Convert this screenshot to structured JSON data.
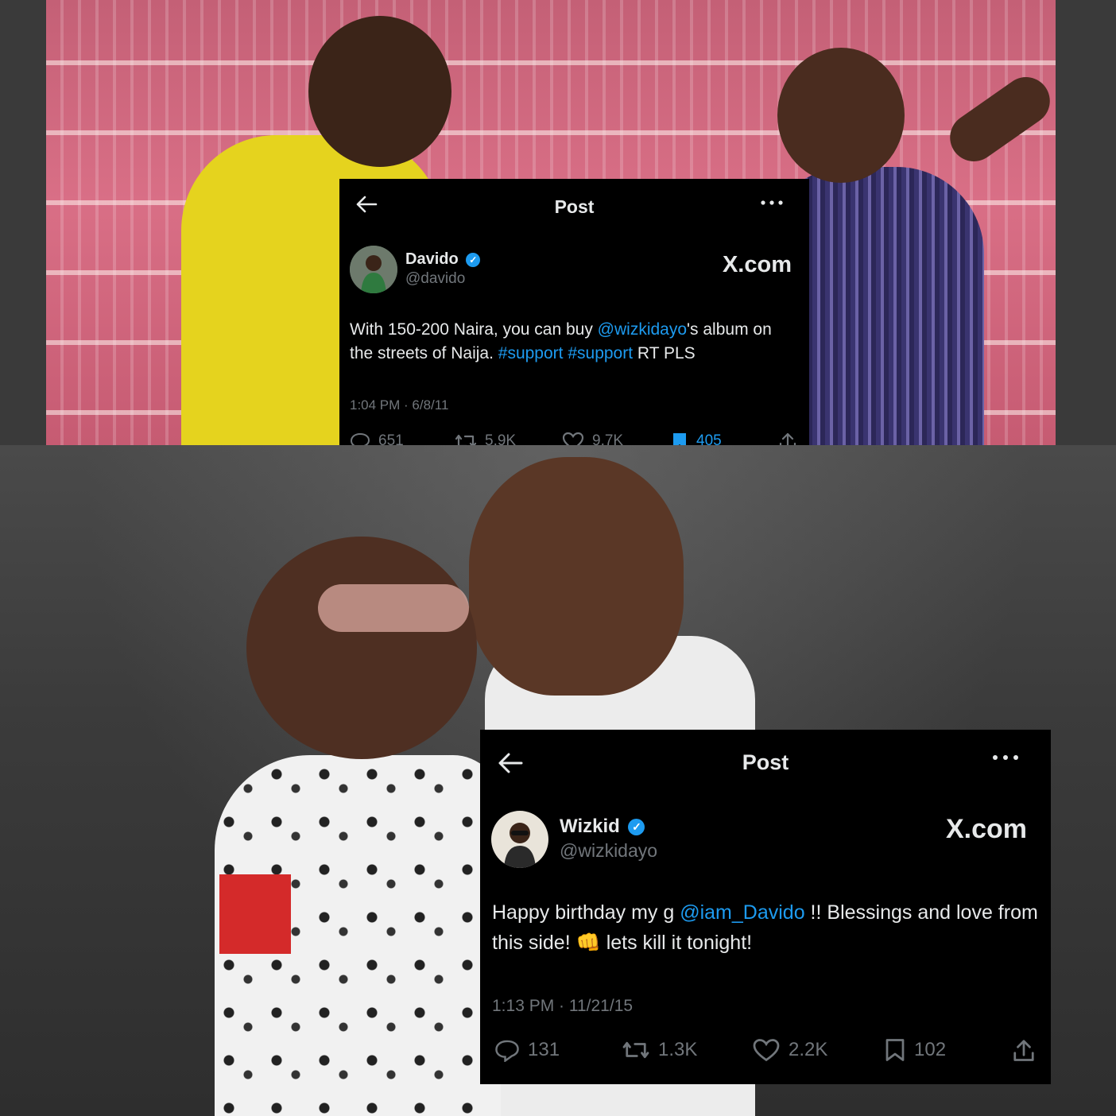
{
  "tweet1": {
    "nav_title": "Post",
    "name": "Davido",
    "handle": "@davido",
    "brand": "X.com",
    "text_before": "With 150-200 Naira, you can buy ",
    "mention": "@wizkidayo",
    "text_mid": "'s album on the streets of Naija. ",
    "hashtag1": "#support",
    "space": " ",
    "hashtag2": "#support",
    "text_after": " RT PLS",
    "timestamp": "1:04 PM · 6/8/11",
    "replies": "651",
    "reposts": "5.9K",
    "likes": "9.7K",
    "bookmarks": "405"
  },
  "tweet2": {
    "nav_title": "Post",
    "name": "Wizkid",
    "handle": "@wizkidayo",
    "brand": "X.com",
    "text_before": "Happy birthday my g ",
    "mention": "@iam_Davido",
    "text_after": " !! Blessings and love from this side! ",
    "emoji": "👊",
    "text_end": " lets kill it tonight!",
    "timestamp": "1:13 PM · 11/21/15",
    "replies": "131",
    "reposts": "1.3K",
    "likes": "2.2K",
    "bookmarks": "102"
  },
  "colors": {
    "link": "#1d9bf0",
    "card_bg": "#000000",
    "muted": "#71767b",
    "text": "#e7e9ea"
  },
  "icons": [
    "back-arrow-icon",
    "more-icon",
    "verified-icon",
    "reply-icon",
    "repost-icon",
    "like-icon",
    "bookmark-icon",
    "share-icon"
  ]
}
